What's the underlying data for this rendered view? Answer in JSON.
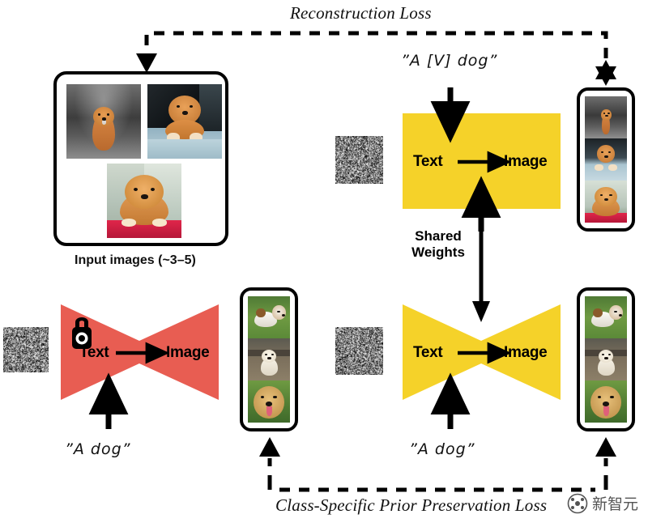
{
  "figure": {
    "title": "DreamBooth fine-tuning diagram",
    "colors": {
      "unet_trainable": "#F5D229",
      "unet_frozen": "#E85D52",
      "stroke": "#000000",
      "background": "#FFFFFF"
    }
  },
  "losses": {
    "reconstruction": "Reconstruction Loss",
    "prior_preservation": "Class-Specific Prior Preservation Loss"
  },
  "prompts": {
    "unique_subject": "”A [V] dog”",
    "class_bottom_left": "”A dog”",
    "class_bottom_right": "”A dog”"
  },
  "captions": {
    "input_images": "Input images (~3–5)",
    "shared_weights": "Shared\nWeights",
    "shared_weights_line1": "Shared",
    "shared_weights_line2": "Weights"
  },
  "unets": {
    "top_right": {
      "text_label": "Text",
      "image_label": "Image",
      "state": "trainable",
      "color": "#F5D229",
      "locked": false
    },
    "bottom_right": {
      "text_label": "Text",
      "image_label": "Image",
      "state": "trainable",
      "color": "#F5D229",
      "locked": false
    },
    "bottom_left": {
      "text_label": "Text",
      "image_label": "Image",
      "state": "frozen",
      "color": "#E85D52",
      "locked": true,
      "lock_icon": "padlock-icon"
    }
  },
  "noise_inputs": [
    {
      "id": "noise-top-right",
      "label": "gaussian-noise"
    },
    {
      "id": "noise-bottom-left",
      "label": "gaussian-noise"
    },
    {
      "id": "noise-bottom-right",
      "label": "gaussian-noise"
    }
  ],
  "image_sets": {
    "input_images": {
      "count": 3,
      "subject": "chow chow dog",
      "photos": [
        {
          "name": "chow-standing-forest",
          "scene": "dark forest path"
        },
        {
          "name": "chow-car-window",
          "scene": "leaning out of car window"
        },
        {
          "name": "chow-red-blanket",
          "scene": "lying on a red blanket"
        }
      ]
    },
    "top_right_outputs": {
      "count": 3,
      "subject": "chow chow dog",
      "photos": [
        {
          "name": "chow-standing-forest",
          "scene": "dark forest path"
        },
        {
          "name": "chow-car-window",
          "scene": "leaning out of car window"
        },
        {
          "name": "chow-red-blanket",
          "scene": "lying on a red blanket"
        }
      ]
    },
    "bottom_left_outputs": {
      "count": 3,
      "subject": "generic dogs",
      "photos": [
        {
          "name": "jack-russell-grass",
          "scene": "jack russell running on grass"
        },
        {
          "name": "white-lab-puppy",
          "scene": "white labrador puppy sitting"
        },
        {
          "name": "golden-retriever-face",
          "scene": "golden retriever closeup"
        }
      ]
    },
    "bottom_right_outputs": {
      "count": 3,
      "subject": "generic dogs",
      "photos": [
        {
          "name": "jack-russell-grass",
          "scene": "jack russell running on grass"
        },
        {
          "name": "white-lab-puppy",
          "scene": "white labrador puppy sitting"
        },
        {
          "name": "golden-retriever-face",
          "scene": "golden retriever closeup"
        }
      ]
    }
  },
  "watermark": {
    "text": "新智元"
  }
}
